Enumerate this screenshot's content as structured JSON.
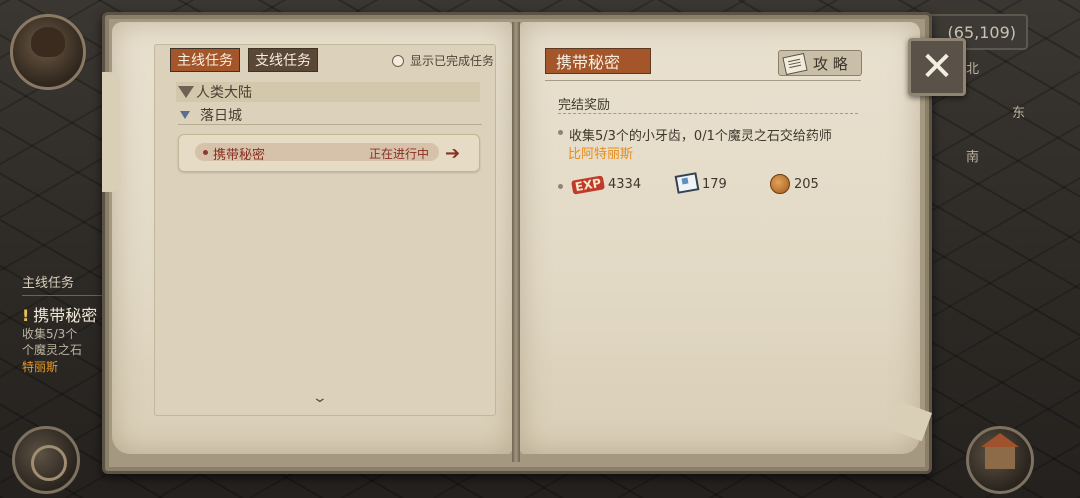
{
  "hud": {
    "coords": "(65,109)",
    "compass": {
      "north": "北",
      "east": "东",
      "south": "南"
    },
    "side_quest": {
      "title": "主线任务",
      "name": "携带秘密",
      "line1": "收集5/3个",
      "line2": "个魔灵之石",
      "npc": "特丽斯"
    }
  },
  "journal": {
    "tabs": {
      "main": "主线任务",
      "side": "支线任务"
    },
    "show_completed": "显示已完成任务",
    "region": "人类大陆",
    "city": "落日城",
    "quest": {
      "name": "携带秘密",
      "status": "正在进行中"
    },
    "detail": {
      "title": "携带秘密",
      "guide_label": "攻 略",
      "reward_label": "完结奖励",
      "description": "收集5/3个的小牙齿，0/1个魔灵之石交给药师",
      "npc": "比阿特丽斯",
      "rewards": {
        "exp_badge": "EXP",
        "exp": "4334",
        "item": "179",
        "coin": "205"
      }
    }
  }
}
